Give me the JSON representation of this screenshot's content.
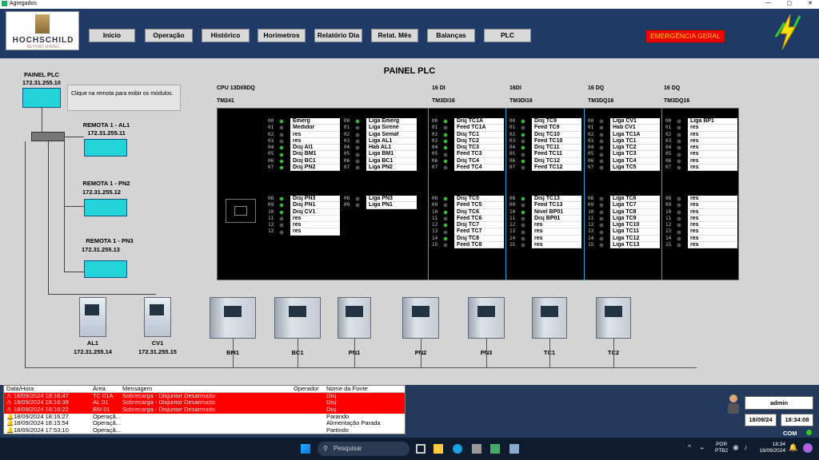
{
  "window": {
    "title": "Agregados"
  },
  "logo": {
    "name": "HOCHSCHILD",
    "tagline": "BEYOND MINING"
  },
  "nav": {
    "inicio": "Inicio",
    "operacao": "Operação",
    "historico": "Histórico",
    "horimetros": "Horimetros",
    "relatorio_dia": "Relatório Dia",
    "relat_mes": "Relat. Mês",
    "balancas": "Balanças",
    "plc": "PLC"
  },
  "emergency": "EMERGÊNCIA GERAL",
  "page": {
    "title": "PAINEL PLC"
  },
  "topology": {
    "plc_label": "PAINEL PLC",
    "plc_ip": "172.31.255.10",
    "hint": "Clique na remota para exibir os módulos.",
    "r1_label": "REMOTA 1 - AL1",
    "r1_ip": "172.31.255.11",
    "r2_label": "REMOTA 1 - PN2",
    "r2_ip": "172.31.255.12",
    "r3_label": "REMOTA 1 - PN3",
    "r3_ip": "172.31.255.13"
  },
  "modules": {
    "cpu": "CPU 13DI/8DQ",
    "cpu_model": "TM241",
    "m1": "16 DI",
    "m1_model": "TM3DI16",
    "m2": "16DI",
    "m2_model": "TM3DI16",
    "m3": "16 DQ",
    "m3_model": "TM3DQ16",
    "m4": "16 DQ",
    "m4_model": "TM3DQ16"
  },
  "io": {
    "a1": [
      "Emerg",
      "Medidor",
      "res",
      "res",
      "Disj AI1",
      "Disj BM1",
      "Disj BC1",
      "Disj PN2"
    ],
    "a2": [
      "Disj PN3",
      "Disj PN1",
      "Disj CV1",
      "res",
      "res",
      "res"
    ],
    "b1": [
      "Liga Emerg",
      "Liga Sirene",
      "Liga Semaf",
      "Liga AL1",
      "Hab AL1",
      "Liga BM1",
      "Liga BC1",
      "Liga PN2"
    ],
    "b2": [
      "Liga PN3",
      "Liga PN1"
    ],
    "c1": [
      "Disj TC1A",
      "Feed TC1A",
      "Disj TC1",
      "Disj TC2",
      "Disj TC3",
      "Feed TC3",
      "Disj TC4",
      "Feed TC4"
    ],
    "c2": [
      "Disj TC5",
      "Feed TC5",
      "Disj TC6",
      "Feed TC6",
      "Disj TC7",
      "Feed TC7",
      "Disj TC8",
      "Feed TC8"
    ],
    "d1": [
      "Disj TC9",
      "Feed TC9",
      "Disj TC10",
      "Feed TC10",
      "Disj TC11",
      "Feed TC11",
      "Disj TC12",
      "Feed TC12"
    ],
    "d2": [
      "Disj TC13",
      "Feed TC13",
      "Nivel BP01",
      "Disj BP01",
      "res",
      "res",
      "res",
      "res"
    ],
    "e1": [
      "Liga CV1",
      "Hab CV1",
      "Liga TC1A",
      "Liga TC1",
      "Liga TC2",
      "Liga TC3",
      "Liga TC4",
      "Liga TC5"
    ],
    "e2": [
      "Liga TC6",
      "Liga TC7",
      "Liga TC8",
      "Liga TC9",
      "Liga TC10",
      "Liga TC11",
      "Liga TC12",
      "Liga TC13"
    ],
    "f1": [
      "Liga BP1",
      "res",
      "res",
      "res",
      "res",
      "res",
      "res",
      "res"
    ],
    "f2": [
      "res",
      "res",
      "res",
      "res",
      "res",
      "res",
      "res",
      "res"
    ]
  },
  "drives": {
    "al1": "AL1",
    "al1_ip": "172.31.255.14",
    "cv1": "CV1",
    "cv1_ip": "172.31.255.15",
    "bm1": "BM1",
    "bc1": "BC1",
    "pn1": "PN1",
    "pn2": "PN2",
    "pn3": "PN3",
    "tc1": "TC1",
    "tc2": "TC2"
  },
  "alarms": {
    "headers": [
      "Data/Hora",
      "Área",
      "Mensagem",
      "Operador",
      "Nome da Fonte"
    ],
    "rows": [
      {
        "dt": "18/09/2024 18:16:47",
        "area": "TC 01A",
        "msg": "Sobrecarga - Disjuntor Desarmado",
        "op": "",
        "src": "Disj",
        "alarm": true
      },
      {
        "dt": "18/09/2024 18:16:39",
        "area": "AL 01",
        "msg": "Sobrecarga - Disjuntor Desarmado",
        "op": "",
        "src": "Disj",
        "alarm": true
      },
      {
        "dt": "18/09/2024 18:16:22",
        "area": "BM 01",
        "msg": "Sobrecarga - Disjuntor Desarmado",
        "op": "",
        "src": "Disj",
        "alarm": true
      },
      {
        "dt": "18/09/2024 18:16:27",
        "area": "Operaçã...",
        "msg": "",
        "op": "",
        "src": "Parando",
        "alarm": false
      },
      {
        "dt": "18/09/2024 18:15:54",
        "area": "Operaçã...",
        "msg": "",
        "op": "",
        "src": "Alimentação Parada",
        "alarm": false
      },
      {
        "dt": "18/09/2024 17:53:10",
        "area": "Operaçã...",
        "msg": "",
        "op": "",
        "src": "Partindo",
        "alarm": false
      }
    ]
  },
  "user": {
    "name": "admin",
    "date": "18/09/24",
    "time": "18:34:08",
    "com": "COM"
  },
  "taskbar": {
    "search": "Pesquisar",
    "lang": "POR",
    "layout": "PTB2",
    "clock_time": "18:34",
    "clock_date": "18/09/2024"
  },
  "colors": {
    "header": "#1f3a66",
    "module": "#22d4d8",
    "alarm": "#ff0000",
    "led_on": "#2ecc2e"
  }
}
